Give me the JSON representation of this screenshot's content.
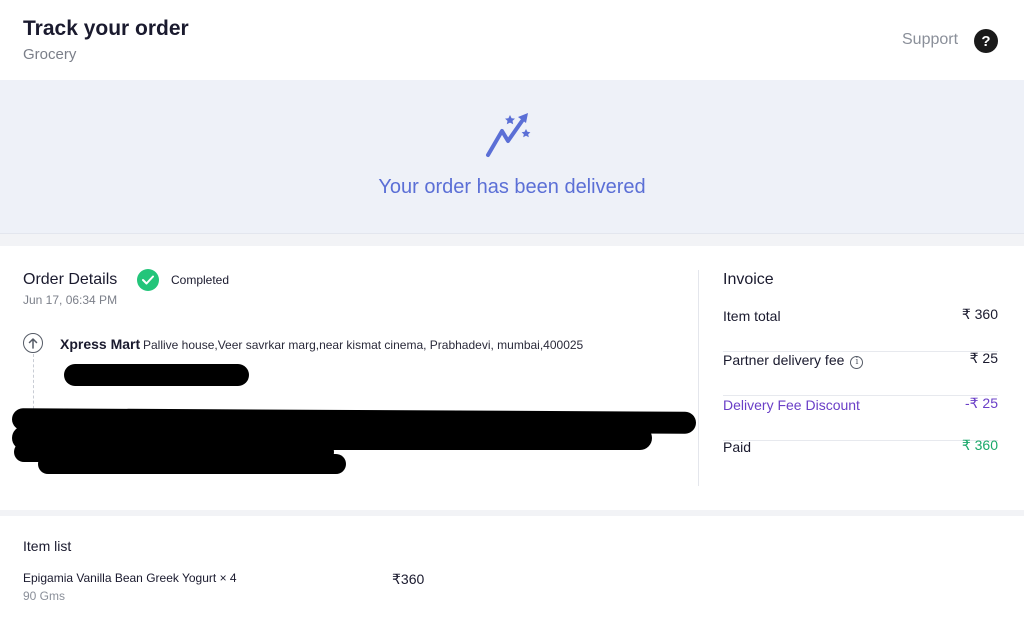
{
  "header": {
    "title": "Track your order",
    "subtitle": "Grocery",
    "support_label": "Support",
    "help_glyph": "?"
  },
  "banner": {
    "icon": "delivery-success-icon",
    "message": "Your order has been delivered",
    "accent_color": "#5b6fd6"
  },
  "order_details": {
    "title": "Order Details",
    "status": "Completed",
    "status_color": "#23c57a",
    "date": "Jun 17, 06:34 PM",
    "pickup": {
      "store_name": "Xpress Mart",
      "address": "Pallive house,Veer savrkar marg,near kismat cinema, Prabhadevi, mumbai,400025"
    }
  },
  "invoice": {
    "title": "Invoice",
    "rows": [
      {
        "label": "Item total",
        "value": "₹ 360"
      },
      {
        "label": "Partner delivery fee",
        "value": "₹ 25"
      },
      {
        "label": "Delivery Fee Discount",
        "value": "-₹ 25"
      },
      {
        "label": "Paid",
        "value": "₹ 360"
      }
    ],
    "discount_color": "#6a3fc7",
    "paid_color": "#1aa86a"
  },
  "item_list": {
    "title": "Item list",
    "items": [
      {
        "name": "Epigamia Vanilla Bean Greek Yogurt × 4",
        "quantity": "90 Gms",
        "price": "₹360"
      }
    ]
  }
}
